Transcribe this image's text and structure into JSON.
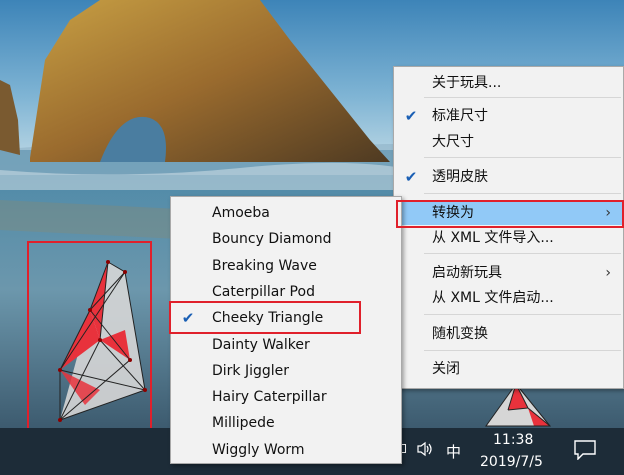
{
  "context_menu": {
    "items": [
      {
        "label": "关于玩具...",
        "checked": false,
        "submenu": false
      },
      {
        "label": "标准尺寸",
        "checked": true,
        "submenu": false
      },
      {
        "label": "大尺寸",
        "checked": false,
        "submenu": false
      },
      {
        "label": "透明皮肤",
        "checked": true,
        "submenu": false
      },
      {
        "label": "转换为",
        "checked": false,
        "submenu": true,
        "selected": true
      },
      {
        "label": "从 XML 文件导入...",
        "checked": false,
        "submenu": false
      },
      {
        "label": "启动新玩具",
        "checked": false,
        "submenu": true
      },
      {
        "label": "从 XML 文件启动...",
        "checked": false,
        "submenu": false
      },
      {
        "label": "随机变换",
        "checked": false,
        "submenu": false
      },
      {
        "label": "关闭",
        "checked": false,
        "submenu": false
      }
    ]
  },
  "convert_submenu": {
    "items": [
      {
        "label": "Amoeba",
        "checked": false
      },
      {
        "label": "Bouncy Diamond",
        "checked": false
      },
      {
        "label": "Breaking Wave",
        "checked": false
      },
      {
        "label": "Caterpillar Pod",
        "checked": false
      },
      {
        "label": "Cheeky Triangle",
        "checked": true
      },
      {
        "label": "Dainty Walker",
        "checked": false
      },
      {
        "label": "Dirk Jiggler",
        "checked": false
      },
      {
        "label": "Hairy Caterpillar",
        "checked": false
      },
      {
        "label": "Millipede",
        "checked": false
      },
      {
        "label": "Wiggly Worm",
        "checked": false
      }
    ]
  },
  "glyphs": {
    "check": "✔",
    "submenu_arrow": "›"
  },
  "taskbar": {
    "ime": "中",
    "time": "11:38",
    "date": "2019/7/5",
    "icons": [
      "tray-box-icon",
      "volume-icon",
      "notification-icon"
    ]
  },
  "colors": {
    "highlight_border": "#e0202b",
    "menu_selected": "#91c9f7",
    "menu_background": "#f2f2f2",
    "taskbar": "#1d2c38",
    "toy_red": "#e8323c"
  }
}
